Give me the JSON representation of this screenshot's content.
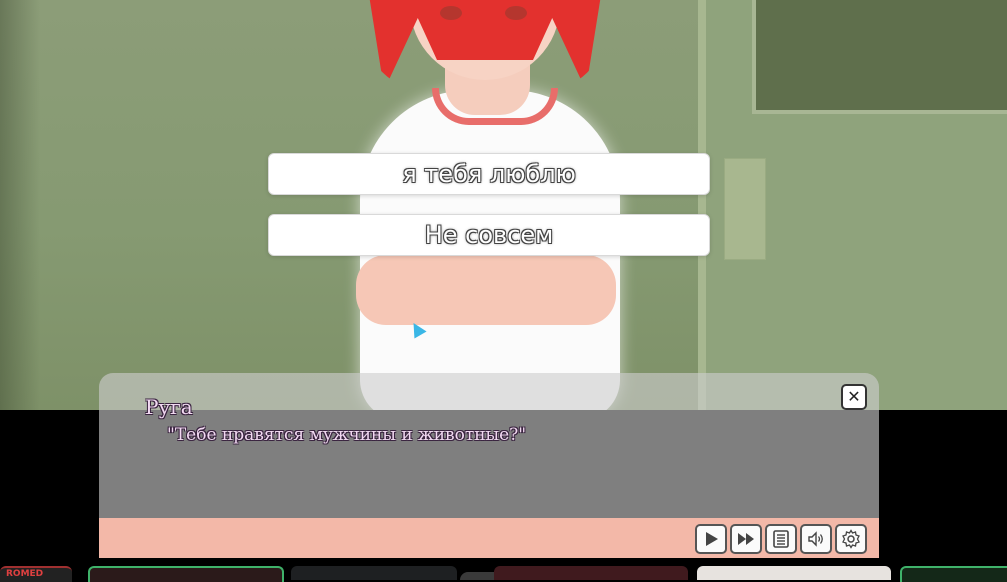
{
  "choices": [
    {
      "label": "я тебя люблю"
    },
    {
      "label": "Не совсем"
    }
  ],
  "dialogue": {
    "speaker": "Руга",
    "text": "\"Тебе нравятся мужчины и животные?\"",
    "close_glyph": "✕"
  },
  "controls": [
    {
      "name": "play-icon"
    },
    {
      "name": "fast-forward-icon"
    },
    {
      "name": "log-icon"
    },
    {
      "name": "sound-icon"
    },
    {
      "name": "gear-icon"
    }
  ],
  "taskbar": {
    "first_thumb_text": "ROMED"
  },
  "colors": {
    "choice_bg": "#ffffff",
    "dialogue_bg": "#cdcdcd",
    "control_bar": "#f3b8a8",
    "name_text": "#f2d9f2"
  }
}
